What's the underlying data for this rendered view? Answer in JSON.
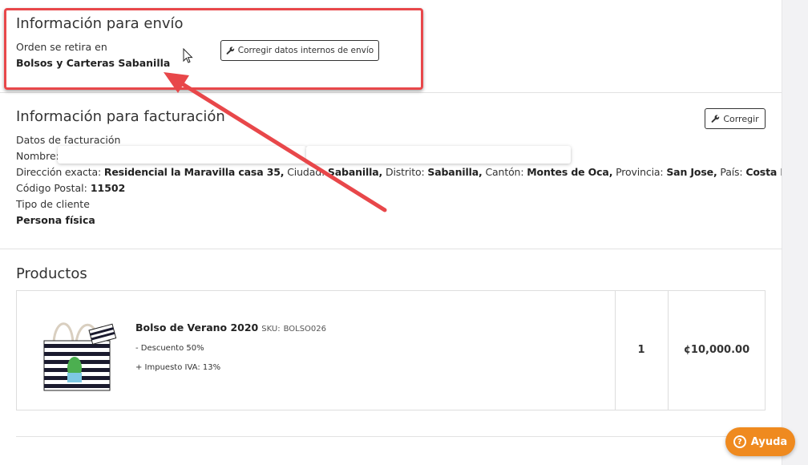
{
  "shipping": {
    "title": "Información para envío",
    "pickup_label": "Orden se retira en",
    "pickup_store": "Bolsos y Carteras Sabanilla",
    "fix_button": "Corregir datos internos de envío"
  },
  "billing": {
    "title": "Información para facturación",
    "fix_button": "Corregir",
    "data_label": "Datos de facturación",
    "name_label": "Nombre:",
    "address_label": "Dirección exacta:",
    "address_value": "Residencial la Maravilla casa 35,",
    "city_label": "Ciudad:",
    "city_value": "Sabanilla,",
    "district_label": "Distrito:",
    "district_value": "Sabanilla,",
    "canton_label": "Cantón:",
    "canton_value": "Montes de Oca,",
    "province_label": "Provincia:",
    "province_value": "San Jose,",
    "country_label": "País:",
    "country_value": "Costa Rica,",
    "postal_label": "Código Postal:",
    "postal_value": "11502",
    "client_type_label": "Tipo de cliente",
    "client_type_value": "Persona física"
  },
  "products": {
    "title": "Productos",
    "items": [
      {
        "name": "Bolso de Verano 2020",
        "sku_label": "SKU:",
        "sku": "BOLSO026",
        "discount": "- Descuento 50%",
        "tax": "+ Impuesto IVA: 13%",
        "quantity": "1",
        "price": "¢10,000.00"
      }
    ]
  },
  "help": {
    "label": "Ayuda"
  },
  "colors": {
    "annotation_red": "#e8474a",
    "help_orange": "#ef8a1f"
  }
}
